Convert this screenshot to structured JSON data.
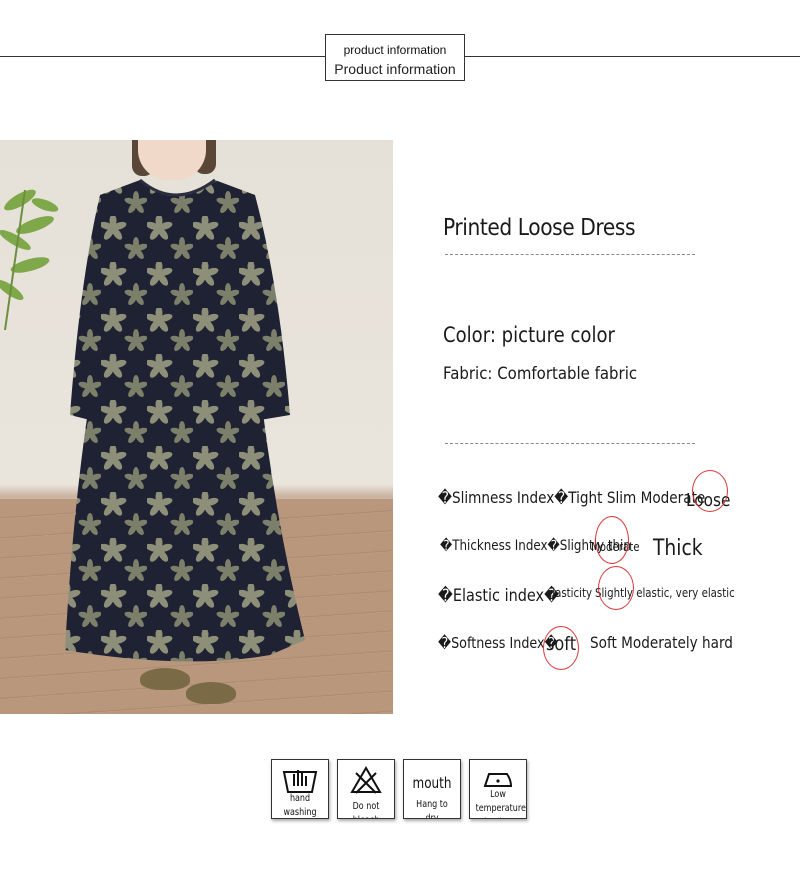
{
  "header": {
    "label_small": "product information",
    "label_large": "Product information"
  },
  "product": {
    "title": "Printed Loose Dress",
    "color": "Color: picture color",
    "fabric": "Fabric: Comfortable fabric"
  },
  "indices": [
    {
      "label": "�Slimness Index�Tight Slim Moderate",
      "options": [
        "Loose"
      ],
      "selected": "Loose"
    },
    {
      "label": "�Thickness Index�Slightly thin",
      "options": [
        "Moderate",
        "Thick"
      ],
      "selected": "Moderate"
    },
    {
      "label": "�Elastic index�",
      "options": [
        "elasticity",
        "Slightly elastic, very elastic"
      ],
      "selected": "Slightly elastic"
    },
    {
      "label": "�Softness Index�",
      "options": [
        "soft",
        "Soft Moderately hard"
      ],
      "selected": "soft"
    }
  ],
  "care": [
    {
      "icon": "hand-wash-icon",
      "label": "hand washing"
    },
    {
      "icon": "no-bleach-icon",
      "label": "Do not bleach"
    },
    {
      "icon": "hang-dry-icon",
      "text": "mouth",
      "label": "Hang to dry"
    },
    {
      "icon": "low-iron-icon",
      "label": "Low temperature ironing"
    }
  ],
  "colors": {
    "accent_circle": "#d83a3a",
    "dress": "#1e2233",
    "flower": "#8d8f78"
  }
}
